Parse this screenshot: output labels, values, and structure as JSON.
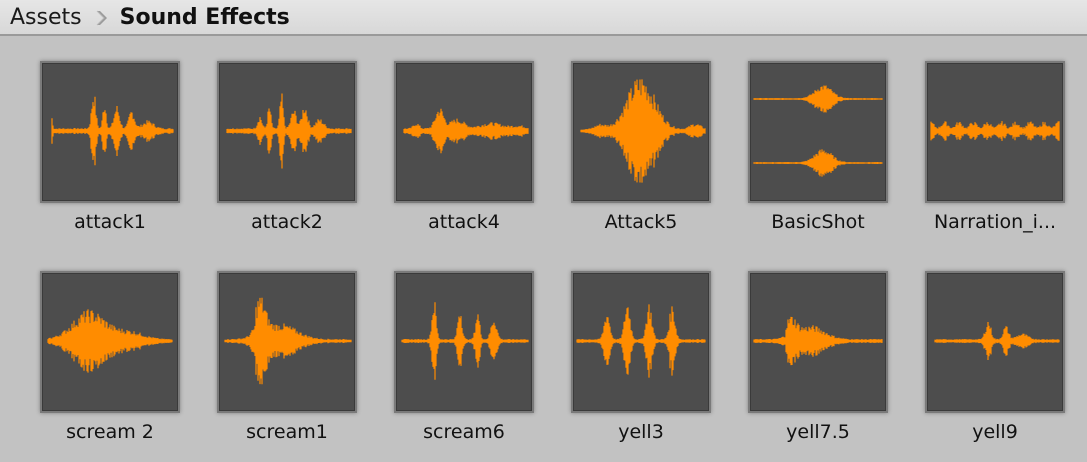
{
  "breadcrumb": {
    "root": "Assets",
    "separator_icon": "chevron-right-icon",
    "current": "Sound Effects"
  },
  "colors": {
    "waveform": "#ff8c00",
    "thumb_bg": "#4d4d4d",
    "panel_bg": "#c2c2c2"
  },
  "assets": [
    {
      "name": "attack1",
      "waveform": "attack1"
    },
    {
      "name": "attack2",
      "waveform": "attack2"
    },
    {
      "name": "attack4",
      "waveform": "attack4"
    },
    {
      "name": "Attack5",
      "waveform": "attack5"
    },
    {
      "name": "BasicShot",
      "waveform": "basicshot"
    },
    {
      "name": "Narration_i...",
      "waveform": "narration"
    },
    {
      "name": "scream 2",
      "waveform": "scream2"
    },
    {
      "name": "scream1",
      "waveform": "scream1"
    },
    {
      "name": "scream6",
      "waveform": "scream6"
    },
    {
      "name": "yell3",
      "waveform": "yell3"
    },
    {
      "name": "yell7.5",
      "waveform": "yell75"
    },
    {
      "name": "yell9",
      "waveform": "yell9"
    }
  ]
}
